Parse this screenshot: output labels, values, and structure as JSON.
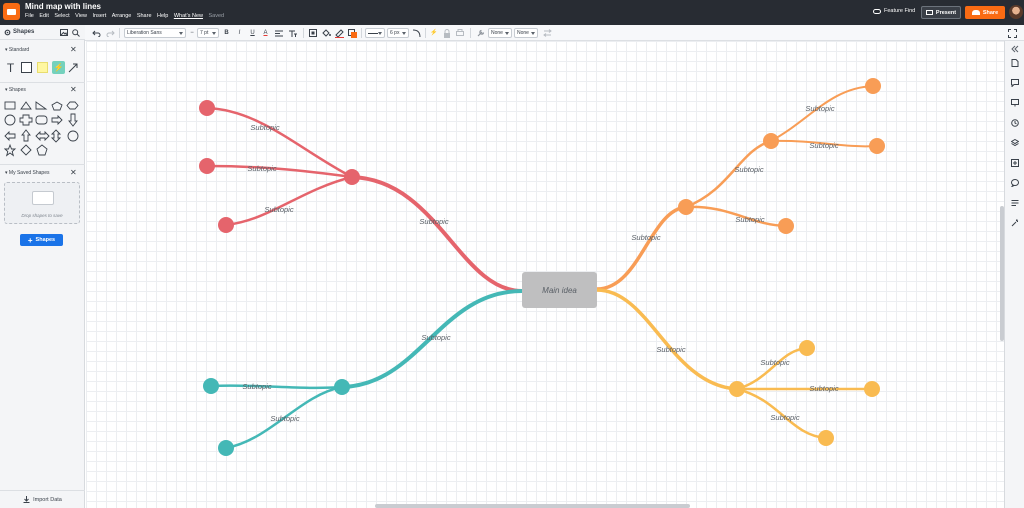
{
  "app": {
    "document_title": "Mind map with lines",
    "menu": [
      "File",
      "Edit",
      "Select",
      "View",
      "Insert",
      "Arrange",
      "Share",
      "Help",
      "What's New"
    ],
    "saved_status": "Saved",
    "feature_find": "Feature Find",
    "present_label": "Present",
    "share_label": "Share",
    "brand_color": "#f96b13"
  },
  "toolbar": {
    "font": "Liberation Sans",
    "font_size": "7 pt",
    "bold": "B",
    "italic": "I",
    "underline": "U",
    "text_color": "A",
    "line_width": "6 px",
    "arrow_start": "None",
    "arrow_end": "None",
    "icons": [
      "undo-icon",
      "redo-icon",
      "align-left-icon",
      "align-icon",
      "fill-icon",
      "line-color-icon",
      "lock-icon",
      "wrench-icon"
    ]
  },
  "left_panel": {
    "title": "Shapes",
    "standard_label": "Standard",
    "shapes_label": "Shapes",
    "my_saved_label": "My Saved Shapes",
    "drop_text": "Drop shapes to save",
    "add_shapes_label": "Shapes",
    "import_label": "Import Data",
    "standard_icons": [
      "text-icon",
      "rectangle-icon",
      "note-icon",
      "hotspot-icon",
      "line-icon"
    ],
    "shape_icons": [
      "rectangle",
      "triangle",
      "right-triangle",
      "pentagon",
      "hexagon",
      "circle",
      "cross",
      "rounded-rectangle",
      "arrow-right",
      "arrow-down",
      "arrow-left",
      "arrow-up",
      "arrow-double-horizontal",
      "arrow-double-vertical",
      "circle-large",
      "star",
      "diamond",
      "pentagon-small"
    ]
  },
  "mindmap": {
    "main_idea": "Main idea",
    "subtopic_label": "Subtopic",
    "colors": {
      "red": "#e5646c",
      "teal": "#44b8b6",
      "orange": "#f89d56",
      "yellow": "#f9bb51",
      "main_fill": "#bfbfc0"
    }
  },
  "right_panel": {
    "icons": [
      "collapse-icon",
      "page-icon",
      "comment-icon",
      "present-icon",
      "history-icon",
      "layers-icon",
      "data-icon",
      "chat-icon",
      "properties-icon",
      "magic-icon"
    ]
  }
}
